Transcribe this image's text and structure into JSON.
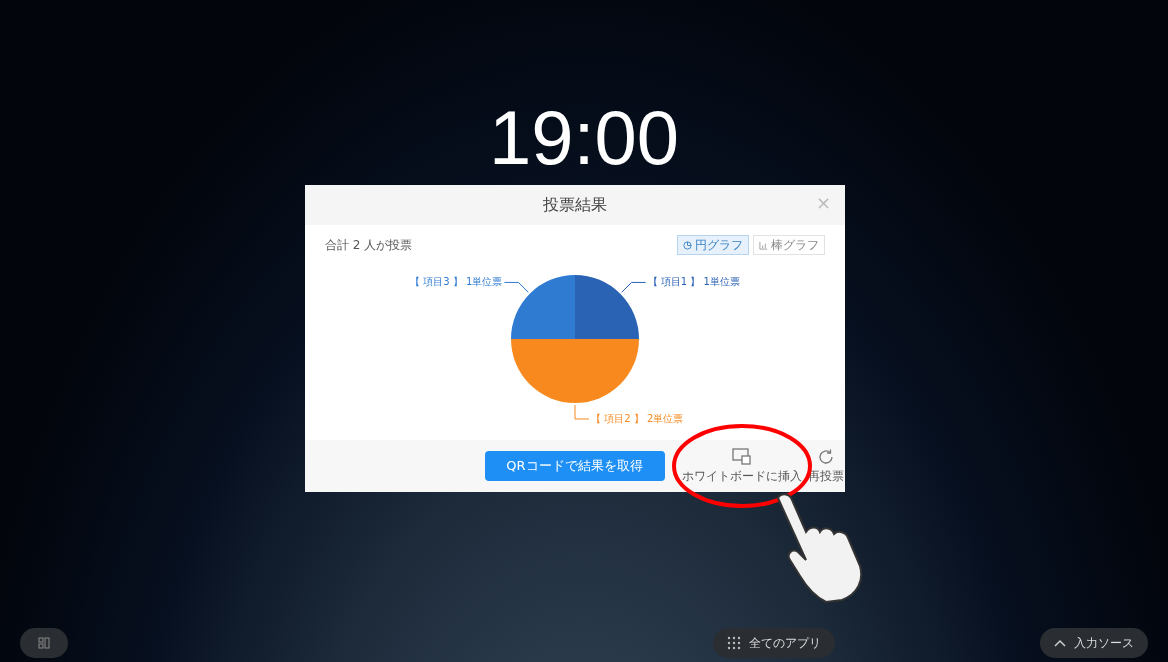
{
  "clock": "19:00",
  "dialog": {
    "title": "投票結果",
    "close": "×",
    "summary": "合計 2 人が投票",
    "chart_tabs": [
      {
        "label": "円グラフ",
        "kind": "pie",
        "selected": true
      },
      {
        "label": "棒グラフ",
        "kind": "bar",
        "selected": false
      }
    ],
    "chart_data": {
      "type": "pie",
      "categories": [
        "【 項目1 】 1単位票",
        "【 項目2 】 2単位票",
        "【 項目3 】 1単位票"
      ],
      "series": [
        {
          "values": [
            1,
            2,
            1
          ]
        }
      ],
      "colors": [
        "#2a62b4",
        "#f7891e",
        "#2f7bd2"
      ]
    },
    "qr_button": "QRコードで結果を取得",
    "actions": [
      {
        "kind": "insert",
        "label": "ホワイトボードに挿入"
      },
      {
        "kind": "revote",
        "label": "再投票"
      }
    ]
  },
  "taskbar": {
    "apps_button": "全てのアプリ",
    "input_source": "入力ソース"
  }
}
